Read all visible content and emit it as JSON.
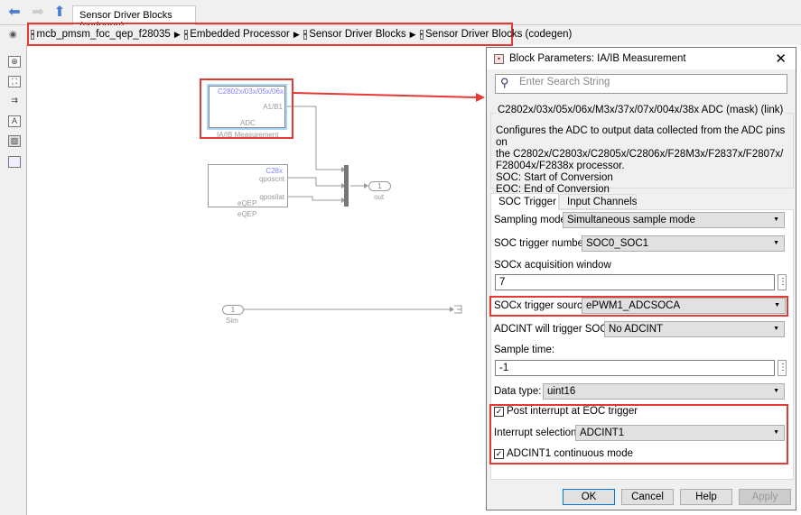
{
  "editor": {
    "tab": "Sensor Driver Blocks (codegen)",
    "breadcrumbs": [
      "mcb_pmsm_foc_qep_f28035",
      "Embedded Processor",
      "Sensor Driver Blocks",
      "Sensor Driver Blocks (codegen)"
    ]
  },
  "toolbar_icons": [
    "zoom-icon",
    "fit-view-icon",
    "arrows-icon",
    "annotation-icon",
    "image-icon",
    "checkbox-icon"
  ],
  "diagram": {
    "adc_block": {
      "device": "C2802x/03x/05x/06x",
      "port": "A1/B1",
      "type": "ADC",
      "name": "IA/IB Measurement"
    },
    "eqep_block": {
      "device": "C28x",
      "port1": "qposcnt",
      "port2": "qposilat",
      "type": "eQEP",
      "name": "eQEP"
    },
    "outport": {
      "num": "1",
      "name": "out"
    },
    "inport": {
      "num": "1",
      "name": "Sim"
    }
  },
  "dialog": {
    "title": "Block Parameters: IA/IB Measurement",
    "search_placeholder": "Enter Search String",
    "group_title": "C2802x/03x/05x/06x/M3x/37x/07x/004x/38x ADC (mask) (link)",
    "description": [
      "Configures the ADC to output data collected from the ADC pins on",
      "the C2802x/C2803x/C2805x/C2806x/F28M3x/F2837x/F2807x/",
      "F28004x/F2838x processor.",
      "SOC: Start of Conversion",
      "EOC: End of Conversion"
    ],
    "tabs": [
      "SOC Trigger",
      "Input Channels"
    ],
    "fields": {
      "sampling_mode": {
        "label": "Sampling mode",
        "value": "Simultaneous sample mode"
      },
      "soc_trigger_number": {
        "label": "SOC trigger number",
        "value": "SOC0_SOC1"
      },
      "acq_window": {
        "label": "SOCx acquisition window",
        "value": "7"
      },
      "trigger_source": {
        "label": "SOCx trigger source",
        "value": "ePWM1_ADCSOCA"
      },
      "adcint_trigger": {
        "label": "ADCINT will trigger SOCx",
        "value": "No ADCINT"
      },
      "sample_time": {
        "label": "Sample time:",
        "value": "-1"
      },
      "data_type": {
        "label": "Data type:",
        "value": "uint16"
      },
      "post_interrupt": {
        "label": "Post interrupt at EOC trigger",
        "checked": true
      },
      "interrupt_selection": {
        "label": "Interrupt selection",
        "value": "ADCINT1"
      },
      "continuous": {
        "label": "ADCINT1 continuous mode",
        "checked": true
      }
    },
    "buttons": {
      "ok": "OK",
      "cancel": "Cancel",
      "help": "Help",
      "apply": "Apply"
    }
  },
  "colors": {
    "highlight": "#e53935",
    "block_selected": "#a8d4f5",
    "device_text": "#8080ff"
  }
}
